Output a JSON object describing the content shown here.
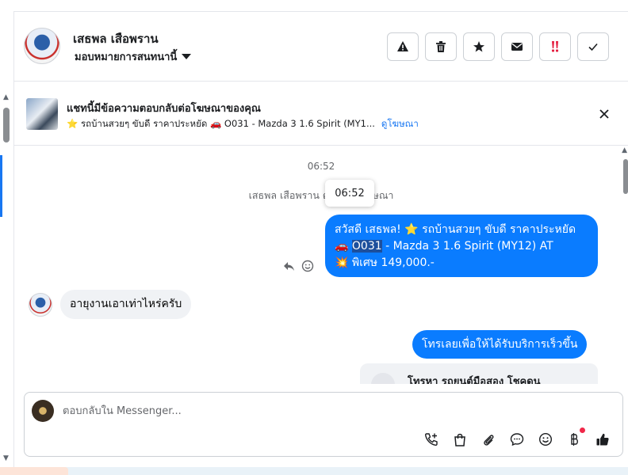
{
  "header": {
    "contact_name": "เสธพล เสือพราน",
    "assign_label": "มอบหมายการสนทนานี้",
    "actions": [
      {
        "icon": "warning-icon",
        "name": "report-spam-button"
      },
      {
        "icon": "trash-icon",
        "name": "delete-button"
      },
      {
        "icon": "star-icon",
        "name": "star-button"
      },
      {
        "icon": "envelope-icon",
        "name": "mark-unread-button"
      },
      {
        "icon": "double-exclamation-icon",
        "name": "follow-up-button"
      },
      {
        "icon": "checkmark-icon",
        "name": "mark-done-button"
      }
    ]
  },
  "ad_banner": {
    "title": "แชทนี้มีข้อความตอบกลับต่อโฆษณาของคุณ",
    "subtitle": "⭐ รถบ้านสวยๆ ขับดี ราคาประหยัด 🚗 O031 - Mazda 3 1.6 Spirit (MY1...",
    "link": "ดูโฆษณา"
  },
  "chat": {
    "timestamp": "06:52",
    "system_message": "เสธพล เสือพราน ตอบกลับโฆษณา",
    "tooltip": "06:52",
    "messages": [
      {
        "direction": "out",
        "line1": "สวัสดี เสธพล! ⭐ รถบ้านสวยๆ ขับดี ราคาประหยัด",
        "line2_prefix": "🚗 ",
        "line2_highlight": "O031",
        "line2_rest": " - Mazda 3 1.6 Spirit (MY12) AT",
        "line3": "💥 พิเศษ 149,000.-"
      },
      {
        "direction": "in",
        "text": "อายุงานเอาเท่าไหร่ครับ"
      },
      {
        "direction": "out",
        "text": "โทรเลยเพื่อให้ได้รับบริการเร็วขึ้น"
      }
    ],
    "card_text": "โทรหา รถยนต์มือสอง โชคดูน"
  },
  "composer": {
    "placeholder": "ตอบกลับใน Messenger...",
    "icons": [
      "call-add-icon",
      "shopping-bag-icon",
      "paperclip-icon",
      "chat-bubble-icon",
      "emoji-icon",
      "baht-icon",
      "thumbs-up-icon"
    ]
  },
  "colors": {
    "accent": "#1877f2",
    "bubble_out": "#0a7cff",
    "bubble_in": "#f0f2f5",
    "follow_up": "#e41e3f"
  }
}
